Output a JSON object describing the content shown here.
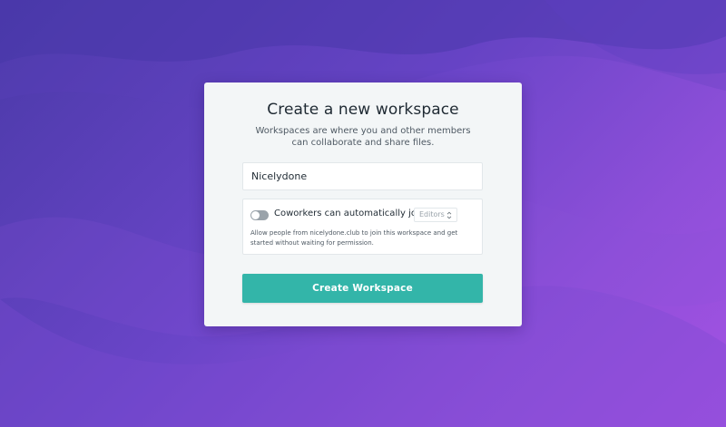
{
  "page": {
    "colors": {
      "background_start": "#4a3aa8",
      "background_end": "#a452e3",
      "card": "#f3f6f7",
      "accent": "#33b5a9",
      "toggle_off": "#9aa3aa"
    }
  },
  "dialog": {
    "title": "Create a new workspace",
    "subtitle": "Workspaces are where you and other members can collaborate and share files.",
    "workspace_name": {
      "value": "Nicelydone",
      "placeholder": ""
    },
    "auto_join": {
      "enabled": false,
      "label": "Coworkers can automatically join as",
      "role": "Editors",
      "help": "Allow people from nicelydone.club to join this workspace and get started without waiting for permission.",
      "toggle_icon": "toggle-switch-icon",
      "select_icon": "sort-chevrons-icon"
    },
    "submit_label": "Create Workspace"
  }
}
